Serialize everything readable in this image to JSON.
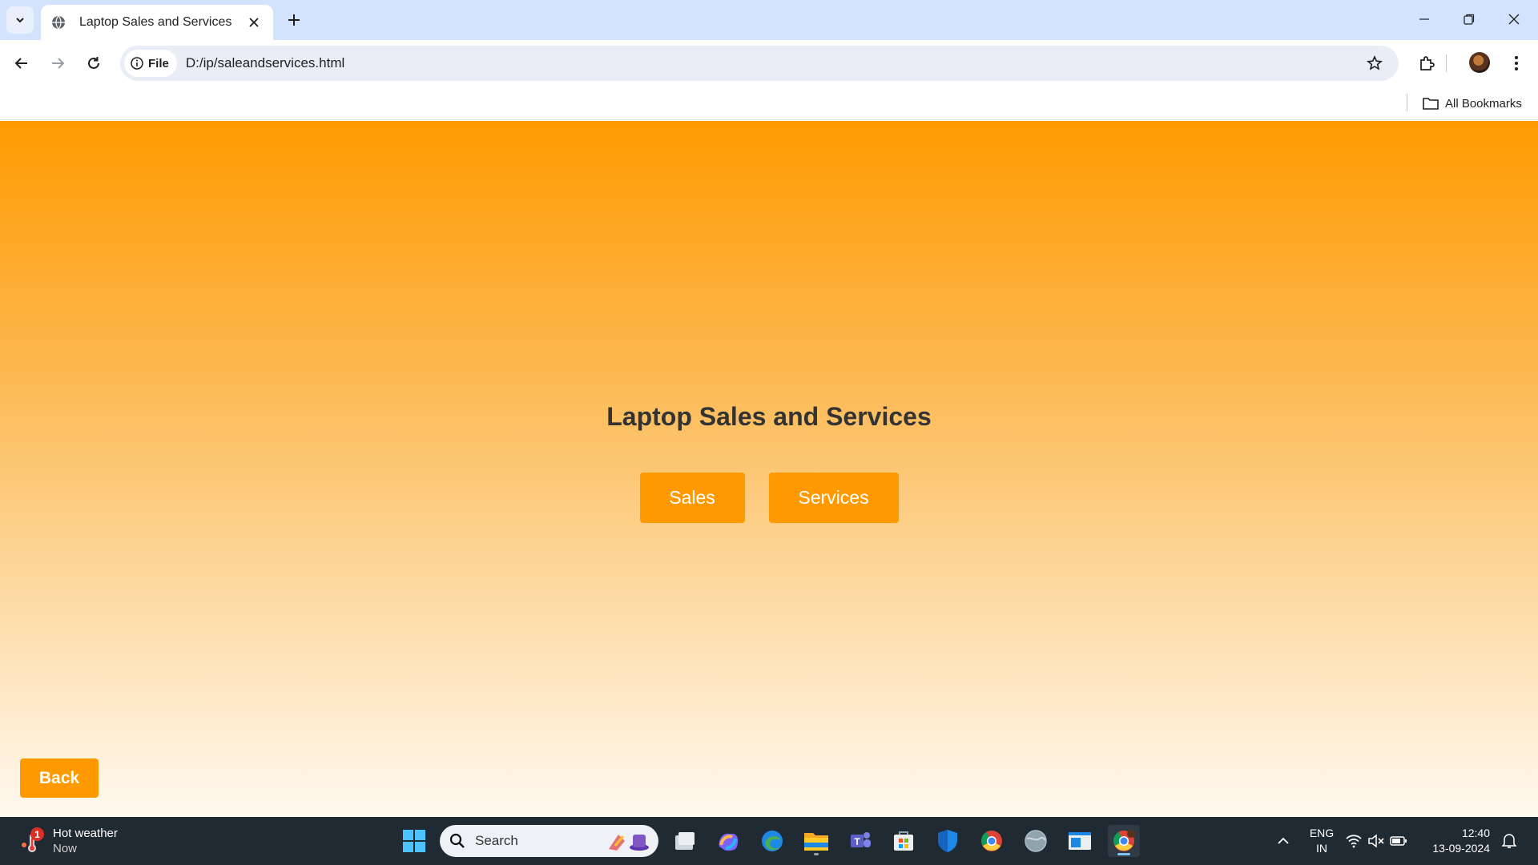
{
  "browser": {
    "tab_title": "Laptop Sales and Services",
    "site_chip_label": "File",
    "url": "D:/ip/saleandservices.html",
    "bookmarks_label": "All Bookmarks",
    "icons": {
      "tab_search": "chevron-down-icon",
      "favicon": "globe-icon",
      "tab_close": "close-icon",
      "new_tab": "plus-icon",
      "minimize": "minimize-icon",
      "restore": "restore-icon",
      "close_window": "close-icon",
      "back": "arrow-left-icon",
      "forward": "arrow-right-icon",
      "reload": "reload-icon",
      "site_info": "info-icon",
      "bookmark_star": "star-icon",
      "extensions": "puzzle-icon",
      "menu": "more-vertical-icon",
      "bookmarks_folder": "folder-icon"
    }
  },
  "page": {
    "title": "Laptop Sales and Services",
    "sales_label": "Sales",
    "services_label": "Services",
    "back_label": "Back",
    "colors": {
      "button": "#ff9900",
      "gradient_top": "#ff9a00",
      "gradient_bottom": "#fff9f0",
      "title_text": "#333333"
    }
  },
  "taskbar": {
    "weather_title": "Hot weather",
    "weather_sub": "Now",
    "weather_badge": "1",
    "search_label": "Search",
    "language_line1": "ENG",
    "language_line2": "IN",
    "time": "12:40",
    "date": "13-09-2024",
    "apps": [
      "windows-start-icon",
      "task-view-icon",
      "copilot-icon",
      "edge-icon",
      "file-explorer-icon",
      "teams-icon",
      "store-icon",
      "defender-icon",
      "chrome-icon",
      "network-globe-icon",
      "app-window-icon",
      "chrome-active-icon"
    ],
    "tray": [
      "chevron-up-icon",
      "wifi-icon",
      "volume-muted-icon",
      "battery-icon",
      "bell-icon"
    ]
  }
}
